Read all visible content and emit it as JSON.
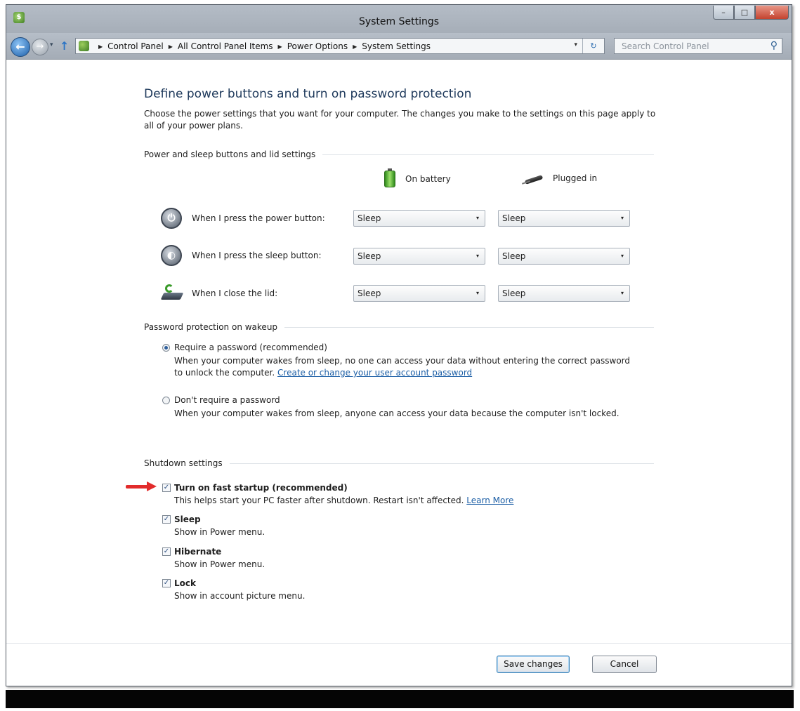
{
  "window": {
    "title": "System Settings",
    "app_icon": "control-panel-icon",
    "caption": {
      "minimize": "–",
      "maximize": "□",
      "close": "x"
    }
  },
  "nav": {
    "back_glyph": "←",
    "forward_glyph": "→",
    "up_glyph": "↑",
    "breadcrumbs": [
      "Control Panel",
      "All Control Panel Items",
      "Power Options",
      "System Settings"
    ],
    "breadcrumb_sep": "▶",
    "dropdown_glyph": "▾",
    "refresh_glyph": "↻",
    "search_placeholder": "Search Control Panel",
    "search_icon_glyph": "⚲"
  },
  "page": {
    "heading": "Define power buttons and turn on password protection",
    "intro": "Choose the power settings that you want for your computer. The changes you make to the settings on this page apply to all of your power plans."
  },
  "power_section": {
    "title": "Power and sleep buttons and lid settings",
    "col_battery": "On battery",
    "col_plugged": "Plugged in",
    "rows": [
      {
        "label": "When I press the power button:",
        "icon": "power-button-icon",
        "battery": "Sleep",
        "plugged": "Sleep"
      },
      {
        "label": "When I press the sleep button:",
        "icon": "sleep-button-icon",
        "battery": "Sleep",
        "plugged": "Sleep"
      },
      {
        "label": "When I close the lid:",
        "icon": "laptop-lid-icon",
        "battery": "Sleep",
        "plugged": "Sleep"
      }
    ]
  },
  "password_section": {
    "title": "Password protection on wakeup",
    "require": {
      "label": "Require a password (recommended)",
      "desc": "When your computer wakes from sleep, no one can access your data without entering the correct password to unlock the computer. ",
      "link": "Create or change your user account password",
      "selected": true
    },
    "no_require": {
      "label": "Don't require a password",
      "desc": "When your computer wakes from sleep, anyone can access your data because the computer isn't locked.",
      "selected": false
    }
  },
  "shutdown_section": {
    "title": "Shutdown settings",
    "fast_startup": {
      "label": "Turn on fast startup (recommended)",
      "desc": "This helps start your PC faster after shutdown. Restart isn't affected. ",
      "link": "Learn More",
      "checked": true
    },
    "sleep": {
      "label": "Sleep",
      "desc": "Show in Power menu.",
      "checked": true
    },
    "hibernate": {
      "label": "Hibernate",
      "desc": "Show in Power menu.",
      "checked": true
    },
    "lock": {
      "label": "Lock",
      "desc": "Show in account picture menu.",
      "checked": true
    }
  },
  "footer": {
    "save_label": "Save changes",
    "cancel_label": "Cancel"
  },
  "check_glyph": "✓",
  "colors": {
    "annotation_arrow": "#e22b2b",
    "heading": "#1e395b",
    "link": "#1d5fa6"
  }
}
